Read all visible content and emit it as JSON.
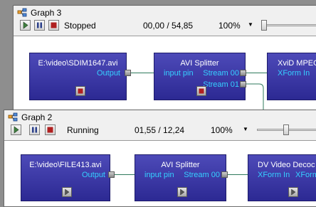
{
  "graph3": {
    "title": "Graph 3",
    "state": "Stopped",
    "time": "00,00 / 54,85",
    "zoom": "100%",
    "filters": [
      {
        "name": "E:\\video\\SDIM1647.avi",
        "pins_out": [
          "Output"
        ]
      },
      {
        "name": "AVI Splitter",
        "pins_in": [
          "input pin"
        ],
        "pins_out": [
          "Stream 00",
          "Stream 01"
        ]
      },
      {
        "name": "XviD MPEG",
        "pins_in": [
          "XForm In"
        ]
      }
    ]
  },
  "graph2": {
    "title": "Graph 2",
    "state": "Running",
    "time": "01,55 / 12,24",
    "zoom": "100%",
    "filters": [
      {
        "name": "E:\\video\\FILE413.avi",
        "pins_out": [
          "Output"
        ]
      },
      {
        "name": "AVI Splitter",
        "pins_in": [
          "input pin"
        ],
        "pins_out": [
          "Stream 00"
        ]
      },
      {
        "name": "DV Video Decoc",
        "pins_in": [
          "XForm In"
        ],
        "pins_out": [
          "XForm"
        ]
      }
    ]
  },
  "icons": {
    "graph": "graph-window-icon",
    "play": "play-icon",
    "pause": "pause-icon",
    "stop": "stop-icon",
    "dropdown": "chevron-down-icon"
  },
  "colors": {
    "filter_fill": "#3a37a6",
    "pin_label": "#35d0ff",
    "connection": "#2f7a5c"
  }
}
